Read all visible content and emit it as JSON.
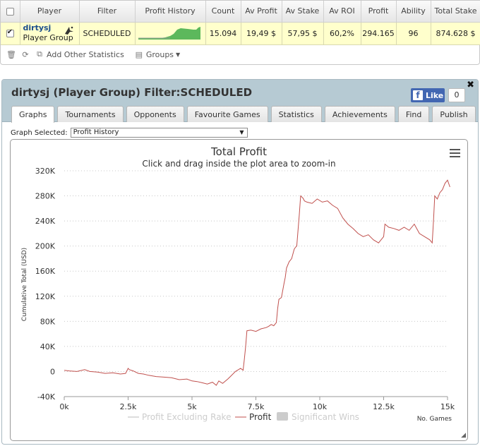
{
  "table": {
    "headers": [
      "",
      "Player",
      "Filter",
      "Profit History",
      "Count",
      "Av Profit",
      "Av Stake",
      "Av ROI",
      "Profit",
      "Ability",
      "Total Stake"
    ],
    "row": {
      "player_name": "dirtysj",
      "player_type": "Player Group",
      "filter": "SCHEDULED",
      "count": "15.094",
      "av_profit": "19,49 $",
      "av_stake": "57,95 $",
      "av_roi": "60,2%",
      "profit": "294.165",
      "ability": "96",
      "total_stake": "874.628 $"
    }
  },
  "toolbar": {
    "add_stats": "Add Other Statistics",
    "groups": "Groups"
  },
  "panel": {
    "title": "dirtysj (Player Group) Filter:SCHEDULED",
    "like_label": "Like",
    "like_count": "0",
    "tabs": [
      "Graphs",
      "Tournaments",
      "Opponents",
      "Favourite Games",
      "Statistics",
      "Achievements",
      "Find",
      "Publish"
    ],
    "graph_selected_label": "Graph Selected:",
    "graph_selected_value": "Profit History"
  },
  "colors": {
    "profit_line": "#c0504d",
    "sparkline": "#5cb85c",
    "header_bg": "#b6cad3",
    "row_highlight": "#ffffcc"
  },
  "chart_data": {
    "type": "line",
    "title": "Total Profit",
    "subtitle": "Click and drag inside the plot area to zoom-in",
    "xlabel": "No. Games",
    "ylabel": "Cumulative Total (USD)",
    "xlim": [
      0,
      15000
    ],
    "ylim": [
      -40000,
      320000
    ],
    "x_ticks": [
      "0k",
      "2.5k",
      "5k",
      "7.5k",
      "10k",
      "12.5k",
      "15k"
    ],
    "y_ticks": [
      "-40K",
      "0",
      "40K",
      "80K",
      "120K",
      "160K",
      "200K",
      "240K",
      "280K",
      "320K"
    ],
    "grid": true,
    "legend_position": "bottom",
    "legend": [
      "Profit Excluding Rake",
      "Profit",
      "Significant Wins"
    ],
    "series": [
      {
        "name": "Profit",
        "x": [
          0,
          200,
          500,
          800,
          1000,
          1300,
          1600,
          1900,
          2200,
          2400,
          2500,
          2550,
          2700,
          2900,
          3100,
          3300,
          3600,
          3900,
          4200,
          4500,
          4800,
          5000,
          5200,
          5400,
          5600,
          5800,
          5950,
          6050,
          6200,
          6400,
          6500,
          6700,
          6900,
          7000,
          7050,
          7100,
          7150,
          7300,
          7500,
          7700,
          7900,
          8000,
          8100,
          8200,
          8300,
          8350,
          8400,
          8500,
          8600,
          8650,
          8700,
          8800,
          8900,
          9000,
          9050,
          9100,
          9200,
          9250,
          9300,
          9350,
          9400,
          9500,
          9700,
          9900,
          10100,
          10300,
          10500,
          10700,
          10900,
          11100,
          11300,
          11500,
          11700,
          11900,
          12100,
          12300,
          12500,
          12550,
          12700,
          12900,
          13100,
          13300,
          13500,
          13700,
          13900,
          14100,
          14300,
          14400,
          14450,
          14500,
          14600,
          14700,
          14800,
          14900,
          15000,
          15094
        ],
        "y": [
          2000,
          1000,
          0,
          3000,
          0,
          -1000,
          -3000,
          -2000,
          -4000,
          -3000,
          5000,
          3000,
          1000,
          -3000,
          -4000,
          -6000,
          -8000,
          -9000,
          -10000,
          -13000,
          -12000,
          -15000,
          -16000,
          -18000,
          -20000,
          -17000,
          -22000,
          -15000,
          -19000,
          -12000,
          -8000,
          0,
          5000,
          2000,
          20000,
          40000,
          65000,
          66000,
          64000,
          68000,
          70000,
          72000,
          75000,
          73000,
          78000,
          100000,
          115000,
          118000,
          140000,
          150000,
          165000,
          175000,
          180000,
          195000,
          198000,
          200000,
          250000,
          280000,
          278000,
          276000,
          272000,
          270000,
          268000,
          275000,
          270000,
          272000,
          265000,
          260000,
          245000,
          235000,
          228000,
          220000,
          215000,
          218000,
          210000,
          205000,
          215000,
          235000,
          230000,
          228000,
          225000,
          230000,
          225000,
          235000,
          220000,
          215000,
          210000,
          205000,
          240000,
          280000,
          275000,
          285000,
          290000,
          300000,
          305000,
          294165
        ]
      }
    ]
  }
}
